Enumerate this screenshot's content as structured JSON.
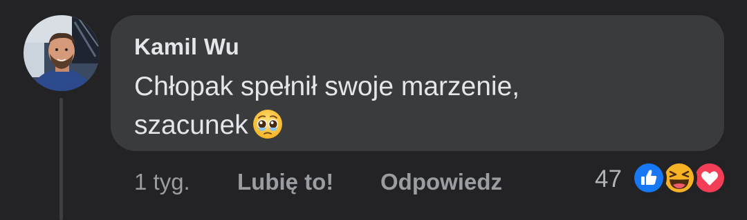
{
  "comment": {
    "author": "Kamil Wu",
    "text_line1": "Chłopak spełnił swoje marzenie,",
    "text_line2": "szacunek",
    "emoji": "pleading-face"
  },
  "actions": {
    "time": "1 tyg.",
    "like_label": "Lubię to!",
    "reply_label": "Odpowiedz"
  },
  "reactions": {
    "count": "47",
    "types": [
      "like",
      "haha",
      "love"
    ]
  },
  "colors": {
    "background": "#232325",
    "bubble": "#3a3b3d",
    "text": "#e4e6eb",
    "muted": "#9a9da2",
    "like_blue": "#1877f2",
    "love_red": "#f33e58",
    "haha_yellow": "#f7b125"
  }
}
